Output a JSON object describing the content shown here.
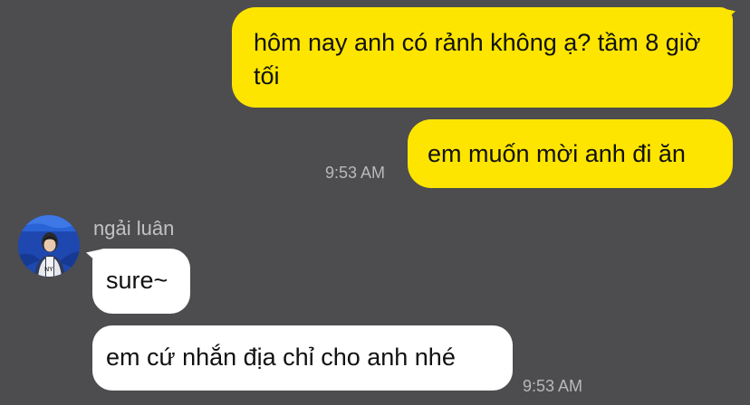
{
  "outgoing": {
    "messages": [
      "hôm nay anh có rảnh không ạ? tầm 8 giờ tối",
      "em muốn mời anh đi ăn"
    ],
    "time": "9:53 AM",
    "bubble_color": "#fde500"
  },
  "incoming": {
    "sender_name": "ngải luân",
    "avatar_icon": "user-avatar-photo",
    "messages": [
      "sure~",
      "em cứ nhắn địa chỉ cho anh nhé"
    ],
    "time": "9:53 AM",
    "bubble_color": "#ffffff"
  },
  "colors": {
    "background": "#4d4c4f",
    "timestamp": "#b9b9bb"
  }
}
